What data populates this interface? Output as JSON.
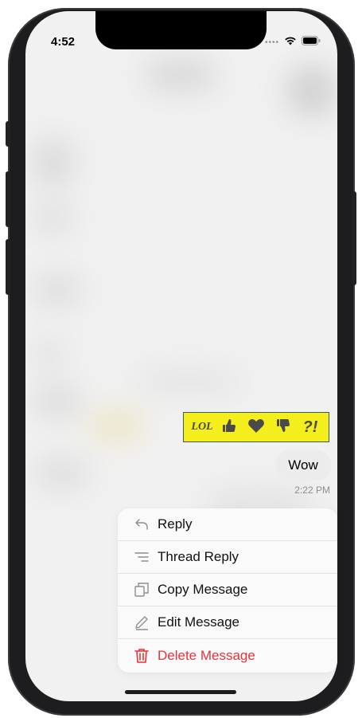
{
  "status_bar": {
    "time": "4:52"
  },
  "reactions": [
    {
      "name": "lol",
      "label": "LOL"
    },
    {
      "name": "thumbs-up",
      "label": ""
    },
    {
      "name": "heart",
      "label": ""
    },
    {
      "name": "thumbs-down",
      "label": ""
    },
    {
      "name": "question-exclamation",
      "label": "?!"
    }
  ],
  "message": {
    "text": "Wow",
    "time": "2:22 PM"
  },
  "menu": {
    "items": [
      {
        "label": "Reply",
        "icon": "reply-icon"
      },
      {
        "label": "Thread Reply",
        "icon": "thread-reply-icon"
      },
      {
        "label": "Copy Message",
        "icon": "copy-icon"
      },
      {
        "label": "Edit Message",
        "icon": "edit-icon"
      },
      {
        "label": "Delete Message",
        "icon": "trash-icon"
      }
    ]
  },
  "colors": {
    "reaction_bar": "#f5ee1d",
    "destructive": "#e8323a",
    "bubble": "#ececec"
  }
}
